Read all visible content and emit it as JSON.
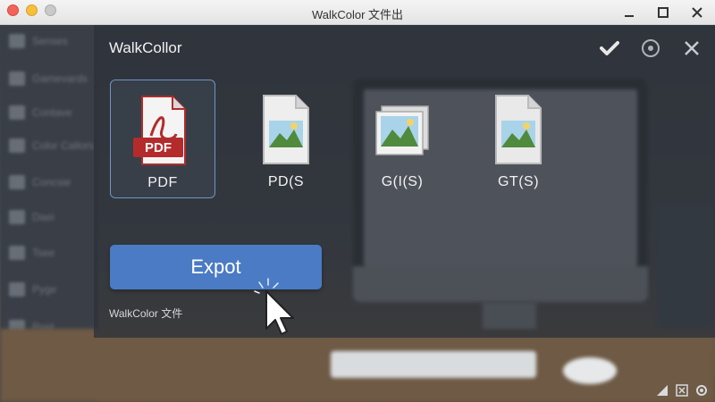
{
  "window": {
    "title": "WalkColor 文件出"
  },
  "sidebar": {
    "items": [
      {
        "label": "Senses",
        "icon": "folder-icon"
      },
      {
        "label": "Gamevards",
        "icon": "user-icon"
      },
      {
        "label": "Contave",
        "icon": "document-icon"
      },
      {
        "label": "Color Callors",
        "icon": "palette-icon"
      },
      {
        "label": "Concsie",
        "icon": "window-icon"
      },
      {
        "label": "Daei",
        "icon": "list-icon"
      },
      {
        "label": "Tsee",
        "icon": "share-icon"
      },
      {
        "label": "Pyge",
        "icon": "page-icon"
      },
      {
        "label": "Rsid",
        "icon": "shield-icon"
      }
    ]
  },
  "dialog": {
    "title": "WalkCollor",
    "header_actions": [
      "check-icon",
      "settings-icon",
      "close-icon"
    ],
    "formats": [
      {
        "label": "PDF",
        "icon": "pdf-file-icon",
        "badge": "PDF",
        "selected": true
      },
      {
        "label": "PD(S",
        "icon": "image-file-icon",
        "selected": false
      },
      {
        "label": "G(I(S)",
        "icon": "image-stack-icon",
        "selected": false
      },
      {
        "label": "GT(S)",
        "icon": "image-file-icon",
        "selected": false
      }
    ],
    "export_label": "Expot",
    "footer": "WalkColor 文件"
  },
  "colors": {
    "accent": "#4a7bc4",
    "pdf_red": "#b32b2b",
    "selection_border": "#6f94c7"
  }
}
